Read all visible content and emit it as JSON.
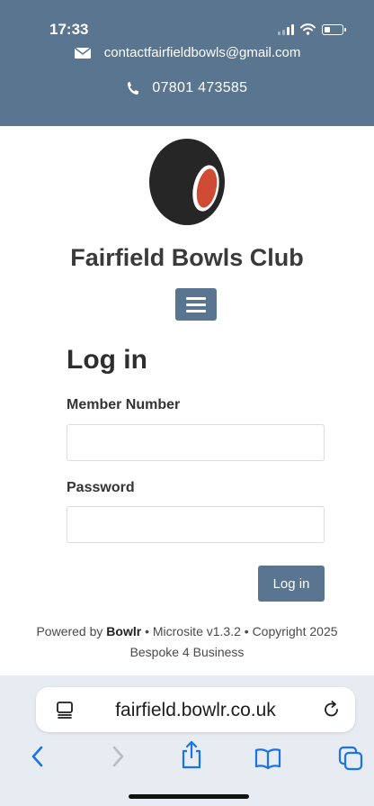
{
  "status_bar": {
    "time": "17:33",
    "battery_level": 0.35
  },
  "header": {
    "email": "contactfairfieldbowls@gmail.com",
    "phone": "07801 473585",
    "background_color": "#5a7590"
  },
  "brand": {
    "club_name": "Fairfield Bowls Club",
    "logo_icon": "bowls-ball-icon"
  },
  "nav": {
    "menu_icon": "hamburger-icon"
  },
  "login": {
    "heading": "Log in",
    "member_number_label": "Member Number",
    "member_number_value": "",
    "password_label": "Password",
    "password_value": "",
    "submit_label": "Log in"
  },
  "footer": {
    "powered_by_prefix": "Powered by",
    "brand": "Bowlr",
    "suffix": "• Microsite v1.3.2 • Copyright 2025",
    "line2": "Bespoke 4 Business"
  },
  "browser": {
    "url": "fairfield.bowlr.co.uk",
    "icons": [
      "page-menu-icon",
      "reload-icon",
      "back-icon",
      "forward-icon",
      "share-icon",
      "bookmarks-icon",
      "tabs-icon"
    ],
    "accent_color": "#1a73e8"
  }
}
